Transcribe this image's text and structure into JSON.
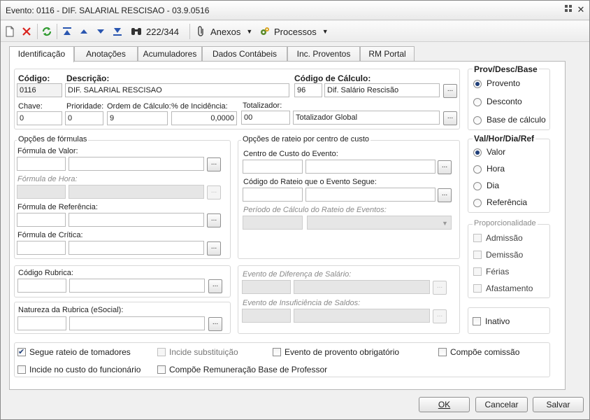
{
  "window": {
    "title": "Evento: 0116 - DIF. SALARIAL RESCISAO - 03.9.0516",
    "menu_icon": "grid-icon",
    "close_icon": "close-icon"
  },
  "toolbar": {
    "record_position": "222/344",
    "anexos_label": "Anexos",
    "processos_label": "Processos"
  },
  "tabs": [
    "Identificação",
    "Anotações",
    "Acumuladores",
    "Dados Contábeis",
    "Inc. Proventos",
    "RM Portal"
  ],
  "main": {
    "codigo_label": "Código:",
    "codigo_value": "0116",
    "descricao_label": "Descrição:",
    "descricao_value": "DIF. SALARIAL RESCISAO",
    "codigo_calculo_label": "Código de Cálculo:",
    "codigo_calculo_code": "96",
    "codigo_calculo_desc": "Dif. Salário Rescisão",
    "chave_label": "Chave:",
    "chave_value": "0",
    "prioridade_label": "Prioridade:",
    "prioridade_value": "0",
    "ordem_label": "Ordem de Cálculo:",
    "ordem_value": "9",
    "incidencia_label": "% de Incidência:",
    "incidencia_value": "0,0000",
    "totalizador_label": "Totalizador:",
    "totalizador_code": "00",
    "totalizador_desc": "Totalizador Global"
  },
  "formulas": {
    "title": "Opções de fórmulas",
    "valor_label": "Fórmula de Valor:",
    "hora_label": "Fórmula de Hora:",
    "referencia_label": "Fórmula de Referência:",
    "critica_label": "Fórmula de Crítica:"
  },
  "rateio": {
    "title": "Opções de rateio por centro de custo",
    "centro_label": "Centro de Custo do Evento:",
    "codigo_rateio_label": "Código do Rateio que o Evento Segue:",
    "periodo_label": "Período de Cálculo do Rateio de Eventos:"
  },
  "rubrica": {
    "codigo_label": "Código Rubrica:",
    "natureza_label": "Natureza da Rubrica (eSocial):"
  },
  "diferenca": {
    "diferenca_label": "Evento de Diferença de Salário:",
    "insuficiencia_label": "Evento de Insuficiência de Saldos:"
  },
  "prov_desc_base": {
    "title": "Prov/Desc/Base",
    "options": [
      "Provento",
      "Desconto",
      "Base de cálculo"
    ],
    "selected": "Provento"
  },
  "val_hor": {
    "title": "Val/Hor/Dia/Ref",
    "options": [
      "Valor",
      "Hora",
      "Dia",
      "Referência"
    ],
    "selected": "Valor"
  },
  "proporcionalidade": {
    "title": "Proporcionalidade",
    "options": [
      "Admissão",
      "Demissão",
      "Férias",
      "Afastamento"
    ]
  },
  "inativo_label": "Inativo",
  "checkboxes": {
    "segue_rateio": "Segue rateio de tomadores",
    "incide_substituicao": "Incide substituição",
    "evento_provento": "Evento de provento obrigatório",
    "compoe_comissao": "Compõe comissão",
    "incide_custo": "Incide no custo do funcionário",
    "compoe_remuneracao": "Compõe Remuneração Base de Professor"
  },
  "buttons": {
    "ok": "OK",
    "cancelar": "Cancelar",
    "salvar": "Salvar"
  },
  "colors": {
    "accent": "#1f3f7a",
    "border": "#b8b8b8"
  }
}
